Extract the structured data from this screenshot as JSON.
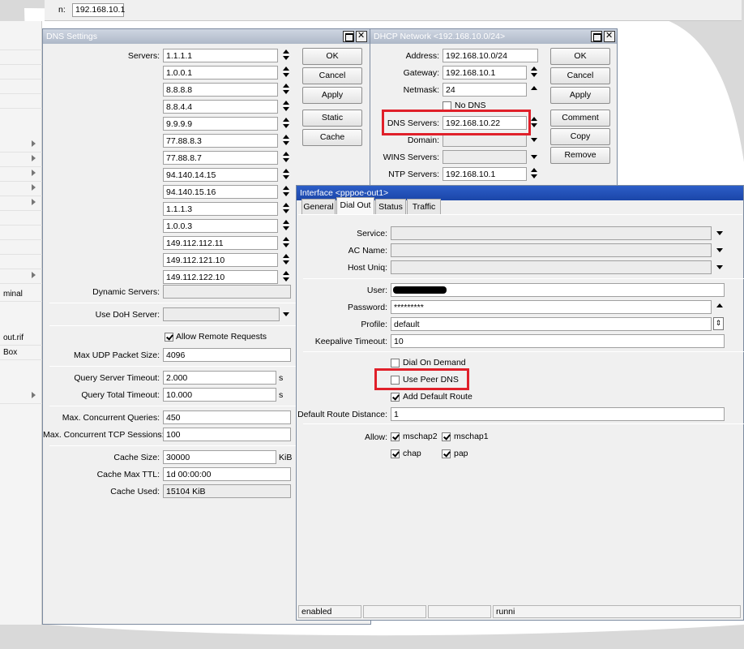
{
  "top_bar": {
    "label": "n:",
    "address_value": "192.168.10.1"
  },
  "sidebar": {
    "items": [
      "minal",
      "out.rif",
      "Box"
    ]
  },
  "dns_window": {
    "title": "DNS Settings",
    "servers_label": "Servers:",
    "servers": [
      "1.1.1.1",
      "1.0.0.1",
      "8.8.8.8",
      "8.8.4.4",
      "9.9.9.9",
      "77.88.8.3",
      "77.88.8.7",
      "94.140.14.15",
      "94.140.15.16",
      "1.1.1.3",
      "1.0.0.3",
      "149.112.112.11",
      "149.112.121.10",
      "149.112.122.10"
    ],
    "dynamic_servers_label": "Dynamic Servers:",
    "dynamic_servers_value": "",
    "doh_label": "Use DoH Server:",
    "doh_value": "",
    "allow_remote_label": "Allow Remote Requests",
    "allow_remote_checked": true,
    "max_udp_label": "Max UDP Packet Size:",
    "max_udp_value": "4096",
    "query_server_timeout_label": "Query Server Timeout:",
    "query_server_timeout_value": "2.000",
    "query_total_timeout_label": "Query Total Timeout:",
    "query_total_timeout_value": "10.000",
    "seconds_unit": "s",
    "max_conc_queries_label": "Max. Concurrent Queries:",
    "max_conc_queries_value": "450",
    "max_conc_tcp_label": "Max. Concurrent TCP Sessions:",
    "max_conc_tcp_value": "100",
    "cache_size_label": "Cache Size:",
    "cache_size_value": "30000",
    "cache_size_unit": "KiB",
    "cache_ttl_label": "Cache Max TTL:",
    "cache_ttl_value": "1d 00:00:00",
    "cache_used_label": "Cache Used:",
    "cache_used_value": "15104 KiB",
    "buttons": {
      "ok": "OK",
      "cancel": "Cancel",
      "apply": "Apply",
      "static": "Static",
      "cache": "Cache"
    }
  },
  "dhcp_window": {
    "title": "DHCP Network <192.168.10.0/24>",
    "address_label": "Address:",
    "address_value": "192.168.10.0/24",
    "gateway_label": "Gateway:",
    "gateway_value": "192.168.10.1",
    "netmask_label": "Netmask:",
    "netmask_value": "24",
    "no_dns_label": "No DNS",
    "no_dns_checked": false,
    "dns_servers_label": "DNS Servers:",
    "dns_servers_value": "192.168.10.22",
    "domain_label": "Domain:",
    "domain_value": "",
    "wins_label": "WINS Servers:",
    "wins_value": "",
    "ntp_label": "NTP Servers:",
    "ntp_value": "192.168.10.1",
    "buttons": {
      "ok": "OK",
      "cancel": "Cancel",
      "apply": "Apply",
      "comment": "Comment",
      "copy": "Copy",
      "remove": "Remove"
    }
  },
  "iface_window": {
    "title": "Interface <pppoe-out1>",
    "tabs": [
      "General",
      "Dial Out",
      "Status",
      "Traffic"
    ],
    "selected_tab": "Dial Out",
    "service_label": "Service:",
    "service_value": "",
    "ac_name_label": "AC Name:",
    "ac_name_value": "",
    "host_uniq_label": "Host Uniq:",
    "host_uniq_value": "",
    "user_label": "User:",
    "password_label": "Password:",
    "password_value": "*********",
    "profile_label": "Profile:",
    "profile_value": "default",
    "keepalive_label": "Keepalive Timeout:",
    "keepalive_value": "10",
    "dial_on_demand_label": "Dial On Demand",
    "dial_on_demand_checked": false,
    "use_peer_dns_label": "Use Peer DNS",
    "use_peer_dns_checked": false,
    "add_default_route_label": "Add Default Route",
    "add_default_route_checked": true,
    "default_route_distance_label": "Default Route Distance:",
    "default_route_distance_value": "1",
    "allow_label": "Allow:",
    "allow_options": [
      {
        "label": "mschap2",
        "checked": true
      },
      {
        "label": "mschap1",
        "checked": true
      },
      {
        "label": "chap",
        "checked": true
      },
      {
        "label": "pap",
        "checked": true
      }
    ],
    "status_text": "enabled",
    "status_running": "runni"
  },
  "colors": {
    "highlight_box": "#e0202a",
    "active_title": "#1b46a8"
  }
}
